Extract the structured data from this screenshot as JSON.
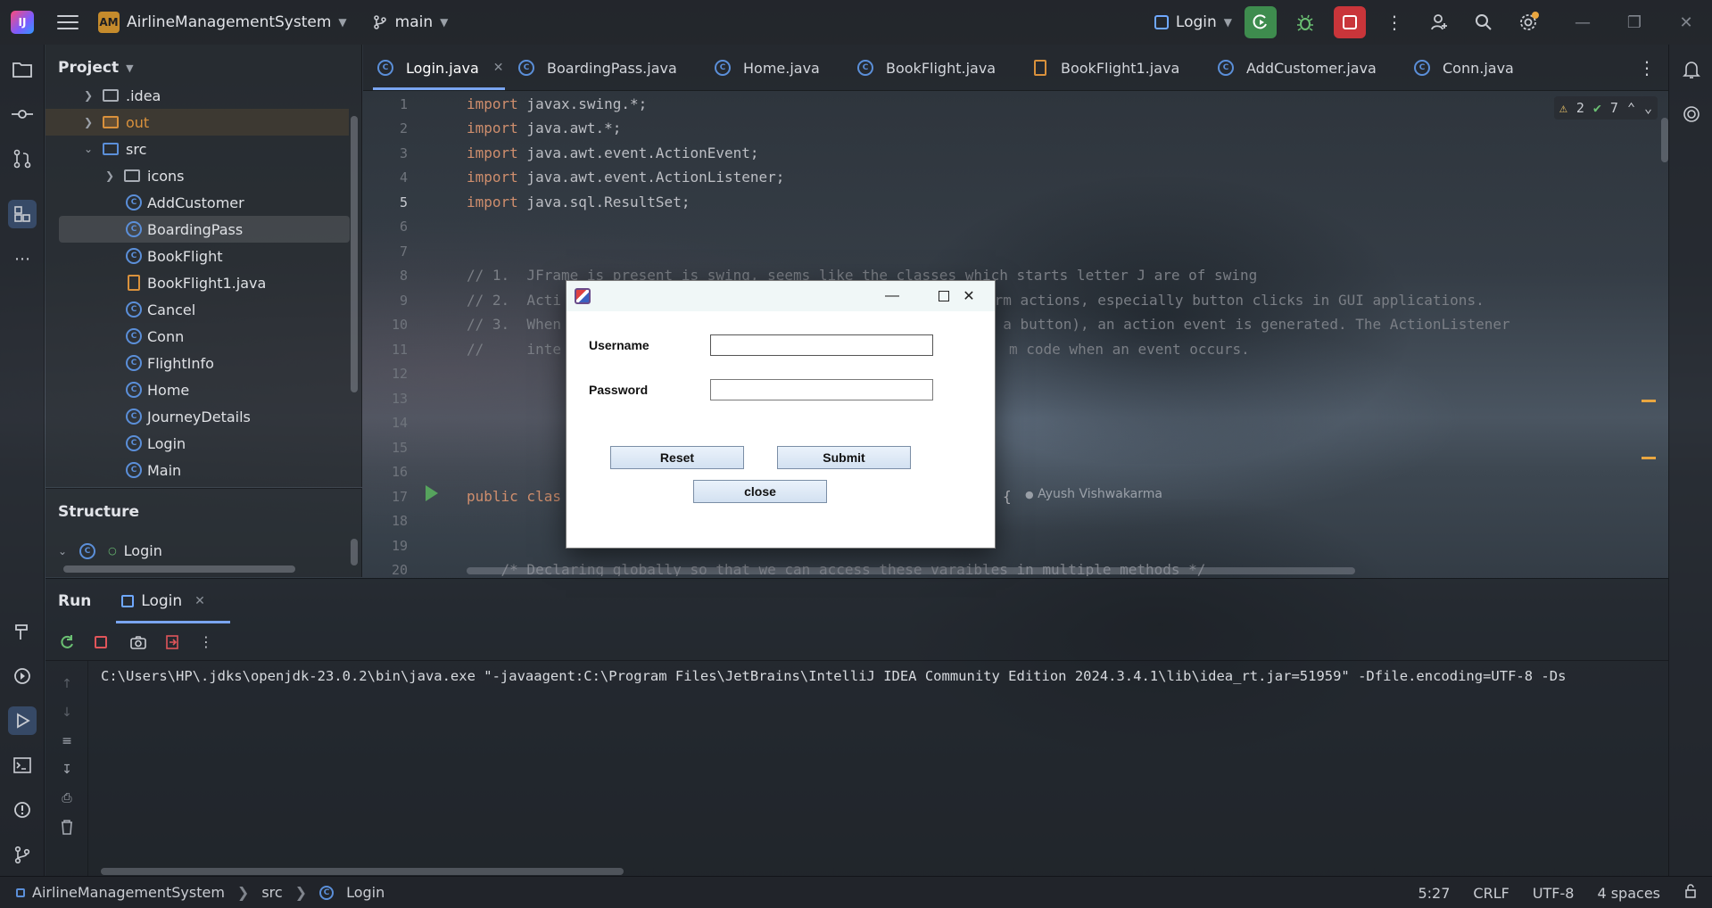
{
  "titlebar": {
    "logo_text": "IJ",
    "project_badge": "AM",
    "project_name": "AirlineManagementSystem",
    "branch": "main",
    "run_config": "Login"
  },
  "project_panel": {
    "title": "Project",
    "items": [
      {
        "label": ".idea",
        "type": "folder"
      },
      {
        "label": "out",
        "type": "folder-orange"
      },
      {
        "label": "src",
        "type": "folder-blue"
      },
      {
        "label": "icons",
        "type": "folder"
      },
      {
        "label": "AddCustomer",
        "type": "class"
      },
      {
        "label": "BoardingPass",
        "type": "class"
      },
      {
        "label": "BookFlight",
        "type": "class"
      },
      {
        "label": "BookFlight1.java",
        "type": "java-file"
      },
      {
        "label": "Cancel",
        "type": "class"
      },
      {
        "label": "Conn",
        "type": "class"
      },
      {
        "label": "FlightInfo",
        "type": "class"
      },
      {
        "label": "Home",
        "type": "class"
      },
      {
        "label": "JourneyDetails",
        "type": "class"
      },
      {
        "label": "Login",
        "type": "class"
      },
      {
        "label": "Main",
        "type": "class"
      }
    ]
  },
  "structure_panel": {
    "title": "Structure",
    "root": "Login"
  },
  "tabs": [
    {
      "label": "Login.java",
      "active": true
    },
    {
      "label": "BoardingPass.java"
    },
    {
      "label": "Home.java"
    },
    {
      "label": "BookFlight.java"
    },
    {
      "label": "BookFlight1.java"
    },
    {
      "label": "AddCustomer.java"
    },
    {
      "label": "Conn.java"
    }
  ],
  "editor": {
    "inspections": {
      "warnings": "2",
      "ok": "7"
    },
    "line_numbers": [
      "1",
      "2",
      "3",
      "4",
      "5",
      "6",
      "7",
      "8",
      "9",
      "10",
      "11",
      "12",
      "13",
      "14",
      "15",
      "16",
      "17",
      "18",
      "19",
      "20"
    ],
    "current_line": "5",
    "lines": {
      "l1_kw": "import",
      "l1_rest": " javax.swing.*;",
      "l2_kw": "import",
      "l2_rest": " java.awt.*;",
      "l3_kw": "import",
      "l3_rest": " java.awt.event.ActionEvent;",
      "l4_kw": "import",
      "l4_rest": " java.awt.event.ActionListener;",
      "l5_kw": "import",
      "l5_rest": " java.sql.ResultSet;",
      "l8": "// 1.  JFrame is present is swing, seems like the classes which starts letter J are of swing",
      "l9a": "// 2.  Acti",
      "l9b": "orm actions, especially button clicks in GUI applications.",
      "l10a": "// 3.  When",
      "l10b": "g a button), an action event is generated. The ActionListener",
      "l11a": "//     inte",
      "l11b": "m code when an event occurs.",
      "l17_kw": "public clas",
      "l17_brace": "{",
      "l20": "    /* Declaring globally so that we can access these varaibles in multiple methods */"
    },
    "author": "Ayush Vishwakarma"
  },
  "run_panel": {
    "title": "Run",
    "tab": "Login",
    "console": "C:\\Users\\HP\\.jdks\\openjdk-23.0.2\\bin\\java.exe \"-javaagent:C:\\Program Files\\JetBrains\\IntelliJ IDEA Community Edition 2024.3.4.1\\lib\\idea_rt.jar=51959\" -Dfile.encoding=UTF-8 -Ds"
  },
  "statusbar": {
    "crumbs": [
      "AirlineManagementSystem",
      "src",
      "Login"
    ],
    "position": "5:27",
    "line_sep": "CRLF",
    "encoding": "UTF-8",
    "indent": "4 spaces"
  },
  "dialog": {
    "username_label": "Username",
    "password_label": "Password",
    "username_value": "",
    "password_value": "",
    "reset_label": "Reset",
    "submit_label": "Submit",
    "close_label": "close"
  }
}
